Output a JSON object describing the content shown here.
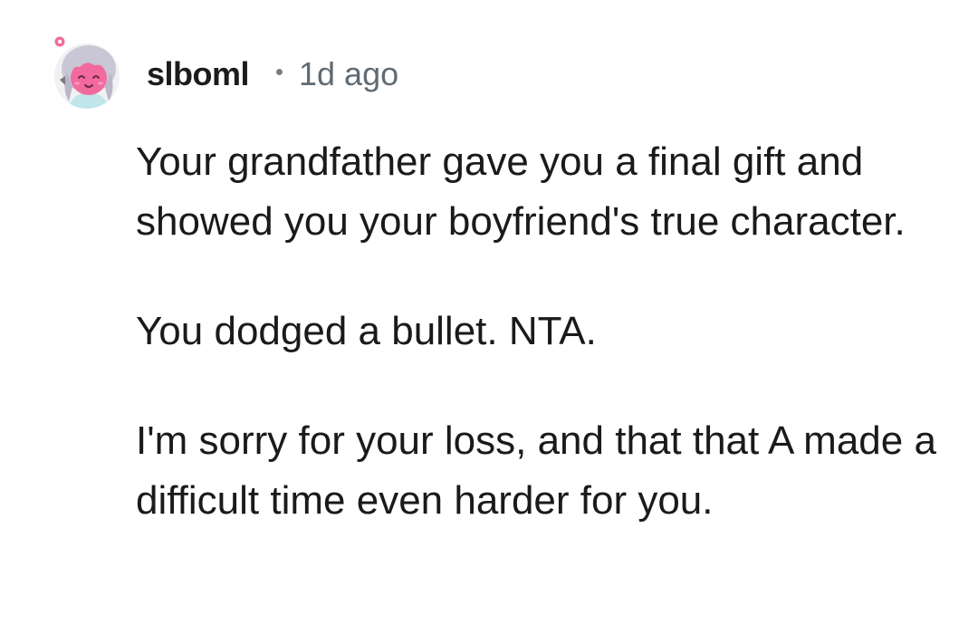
{
  "comment": {
    "author": "slboml",
    "timestamp": "1d ago",
    "avatar_icon": "anime-girl-avatar-icon",
    "paragraphs": [
      "Your grandfather gave you a final gift and showed you your boyfriend's true character.",
      "You dodged a bullet. NTA.",
      "I'm sorry for your loss, and that that A made a difficult time even harder for you."
    ]
  },
  "colors": {
    "text": "#1a1a1b",
    "meta": "#5f6b73",
    "background": "#ffffff",
    "avatar_skin": "#f26a9d",
    "avatar_hair": "#c9c7d6"
  }
}
